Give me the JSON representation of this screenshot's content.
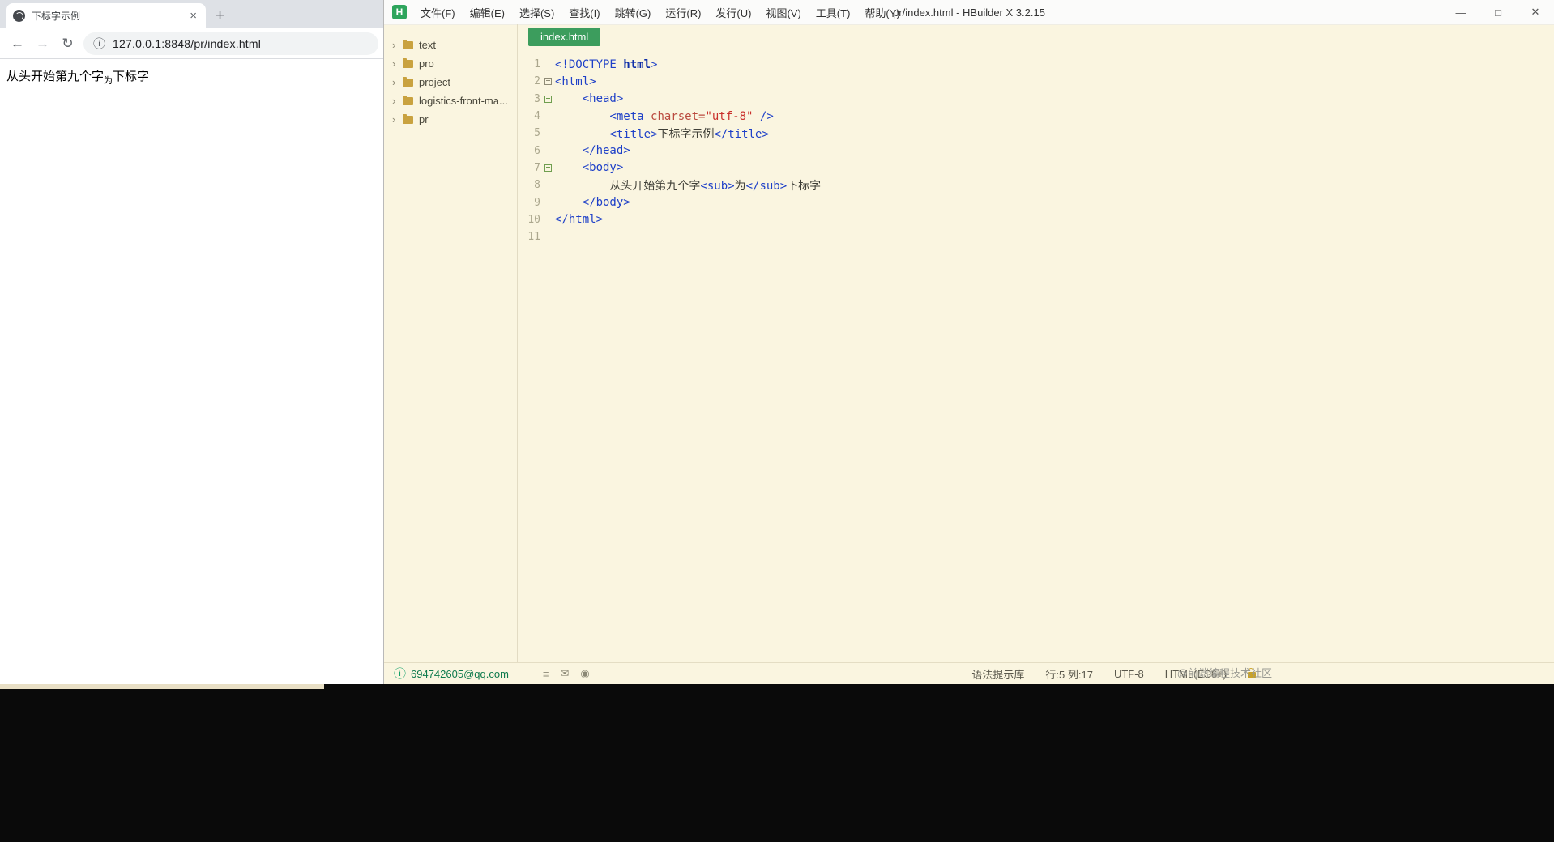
{
  "colors": {
    "accent-green": "#3C9D5D",
    "editor-bg": "#FAF5E0",
    "tag-blue": "#1E40C8",
    "attr-red": "#BA4A3F",
    "string-red": "#C9302B"
  },
  "icons": {
    "chevron": "›",
    "back": "←",
    "forward": "→",
    "reload": "↻",
    "info": "ⓘ",
    "tab_close": "×",
    "new_tab": "+",
    "minimize": "—",
    "maximize": "□",
    "close": "✕",
    "account": "ⓘ",
    "list": "≡",
    "mail": "✉",
    "circle": "◉"
  },
  "browser": {
    "tab": {
      "title": "下标字示例"
    },
    "toolbar": {
      "url": "127.0.0.1:8848/pr/index.html"
    },
    "page": {
      "before": "从头开始第九个字",
      "sub": "为",
      "after": "下标字"
    }
  },
  "ide": {
    "titlebar": {
      "logo": "H",
      "menus": [
        "文件(F)",
        "编辑(E)",
        "选择(S)",
        "查找(I)",
        "跳转(G)",
        "运行(R)",
        "发行(U)",
        "视图(V)",
        "工具(T)",
        "帮助(Y)"
      ],
      "title": "pr/index.html - HBuilder X 3.2.15"
    },
    "sidebar": {
      "items": [
        {
          "label": "text"
        },
        {
          "label": "pro"
        },
        {
          "label": "project"
        },
        {
          "label": "logistics-front-ma..."
        },
        {
          "label": "pr"
        }
      ]
    },
    "editor": {
      "tab": "index.html",
      "lines": [
        {
          "n": "1",
          "fold": "",
          "seg": [
            {
              "t": "<!DOCTYPE ",
              "c": "tag"
            },
            {
              "t": "html",
              "c": "doctype"
            },
            {
              "t": ">",
              "c": "tag"
            }
          ]
        },
        {
          "n": "2",
          "fold": "gray",
          "seg": [
            {
              "t": "<html>",
              "c": "tag"
            }
          ]
        },
        {
          "n": "3",
          "fold": "green",
          "seg": [
            {
              "t": "    ",
              "c": "plain"
            },
            {
              "t": "<head>",
              "c": "tag"
            }
          ]
        },
        {
          "n": "4",
          "fold": "",
          "seg": [
            {
              "t": "        ",
              "c": "plain"
            },
            {
              "t": "<meta ",
              "c": "tag"
            },
            {
              "t": "charset=",
              "c": "attr"
            },
            {
              "t": "\"utf-8\"",
              "c": "str"
            },
            {
              "t": " />",
              "c": "tag"
            }
          ]
        },
        {
          "n": "5",
          "fold": "",
          "seg": [
            {
              "t": "        ",
              "c": "plain"
            },
            {
              "t": "<title>",
              "c": "tag"
            },
            {
              "t": "下标字示例",
              "c": "plain"
            },
            {
              "t": "</title>",
              "c": "tag"
            }
          ]
        },
        {
          "n": "6",
          "fold": "",
          "seg": [
            {
              "t": "    ",
              "c": "plain"
            },
            {
              "t": "</head>",
              "c": "tag"
            }
          ]
        },
        {
          "n": "7",
          "fold": "green",
          "seg": [
            {
              "t": "    ",
              "c": "plain"
            },
            {
              "t": "<body>",
              "c": "tag"
            }
          ]
        },
        {
          "n": "8",
          "fold": "",
          "seg": [
            {
              "t": "        ",
              "c": "plain"
            },
            {
              "t": "从头开始第九个字",
              "c": "plain"
            },
            {
              "t": "<sub>",
              "c": "tag"
            },
            {
              "t": "为",
              "c": "plain"
            },
            {
              "t": "</sub>",
              "c": "tag"
            },
            {
              "t": "下标字",
              "c": "plain"
            }
          ]
        },
        {
          "n": "9",
          "fold": "",
          "seg": [
            {
              "t": "    ",
              "c": "plain"
            },
            {
              "t": "</body>",
              "c": "tag"
            }
          ]
        },
        {
          "n": "10",
          "fold": "",
          "seg": [
            {
              "t": "</html>",
              "c": "tag"
            }
          ]
        },
        {
          "n": "11",
          "fold": "",
          "seg": []
        }
      ]
    },
    "statusbar": {
      "account": "694742605@qq.com",
      "right": [
        "语法提示库",
        "行:5 列:17",
        "UTF-8",
        "HTML(ES6+)"
      ]
    },
    "watermark": "@前端编程技术社区"
  }
}
